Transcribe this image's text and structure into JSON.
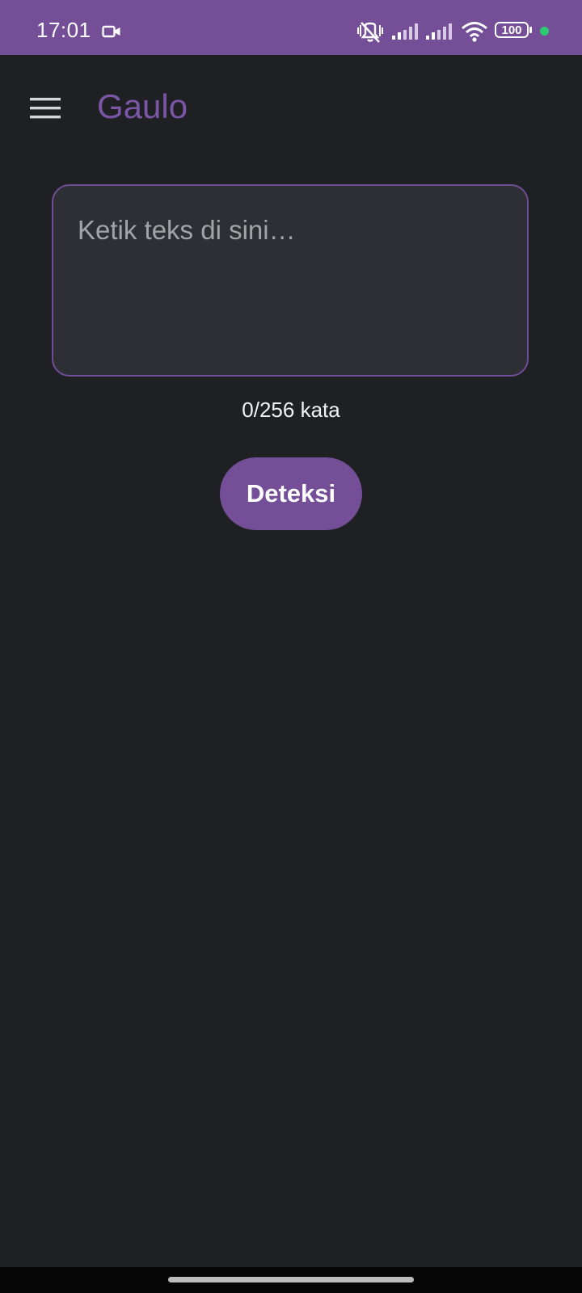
{
  "status_bar": {
    "time": "17:01",
    "battery": "100",
    "background": "#744f98",
    "icons": [
      "video-recording-icon",
      "vibrate-muted-icon",
      "signal-icon",
      "signal-icon",
      "wifi-icon",
      "battery-icon",
      "privacy-dot-icon"
    ]
  },
  "app_bar": {
    "title": "Gaulo",
    "menu_icon": "hamburger-menu-icon",
    "title_color": "#7b56a6"
  },
  "input": {
    "value": "",
    "placeholder": "Ketik teks di sini…",
    "border_color": "#6f4e95"
  },
  "word_count": {
    "text": "0/256 kata"
  },
  "detect_button": {
    "label": "Deteksi",
    "color": "#744f98"
  },
  "colors": {
    "background": "#1f2024",
    "accent": "#744f98"
  }
}
